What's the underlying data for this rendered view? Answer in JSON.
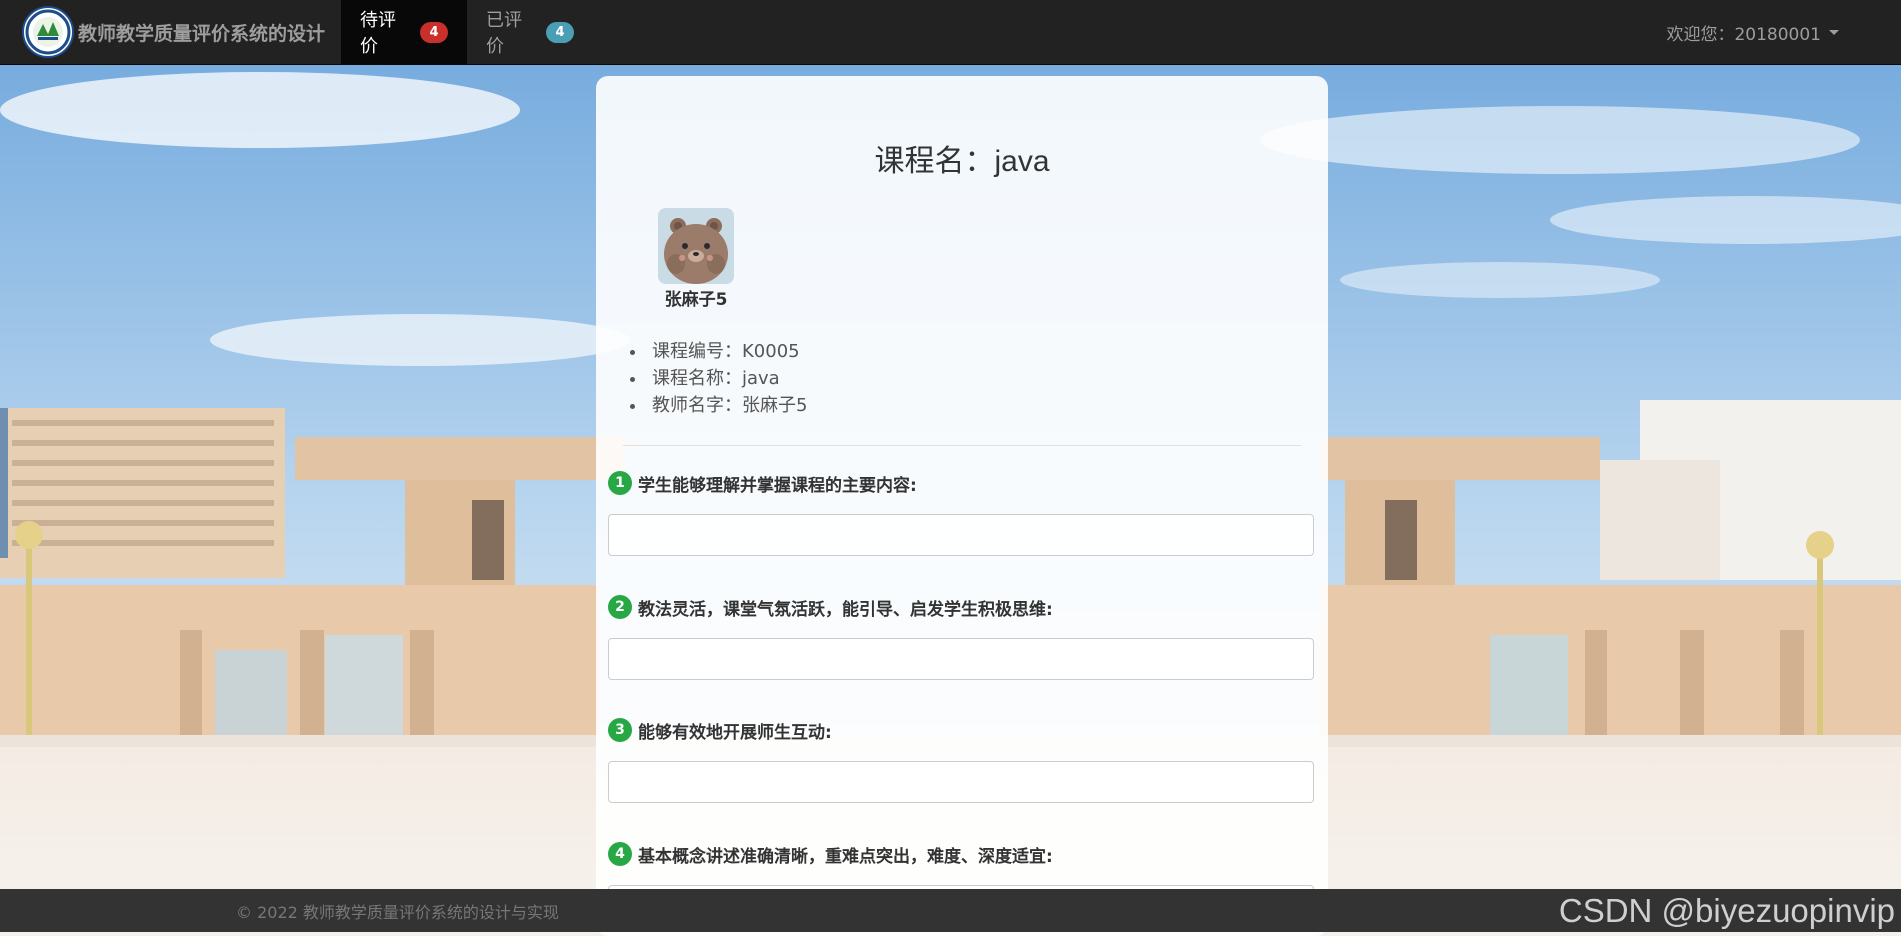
{
  "navbar": {
    "brand": "教师教学质量评价系统的设计",
    "tabs": [
      {
        "label": "待评价",
        "badge": "4",
        "active": true
      },
      {
        "label": "已评价",
        "badge": "4",
        "active": false
      }
    ],
    "user": "欢迎您：20180001"
  },
  "course": {
    "title": "课程名：java",
    "teacher_name": "张麻子5",
    "info": [
      "课程编号：K0005",
      "课程名称：java",
      "教师名字：张麻子5"
    ]
  },
  "questions": [
    {
      "num": "1",
      "label": "学生能够理解并掌握课程的主要内容:",
      "value": ""
    },
    {
      "num": "2",
      "label": "教法灵活，课堂气氛活跃，能引导、启发学生积极思维:",
      "value": ""
    },
    {
      "num": "3",
      "label": "能够有效地开展师生互动:",
      "value": ""
    },
    {
      "num": "4",
      "label": "基本概念讲述准确清晰，重难点突出，难度、深度适宜:",
      "value": ""
    }
  ],
  "footer": {
    "copyright": "© 2022 教师教学质量评价系统的设计与实现",
    "watermark": "CSDN @biyezuopinvip"
  },
  "colors": {
    "navbar": "#222222",
    "badge_pending": "#c9302c",
    "badge_done": "#4a9fb5",
    "question_number": "#28a745"
  },
  "icons": {
    "logo": "school-emblem-icon",
    "avatar": "bear-avatar-image",
    "dropdown": "caret-down-icon"
  }
}
